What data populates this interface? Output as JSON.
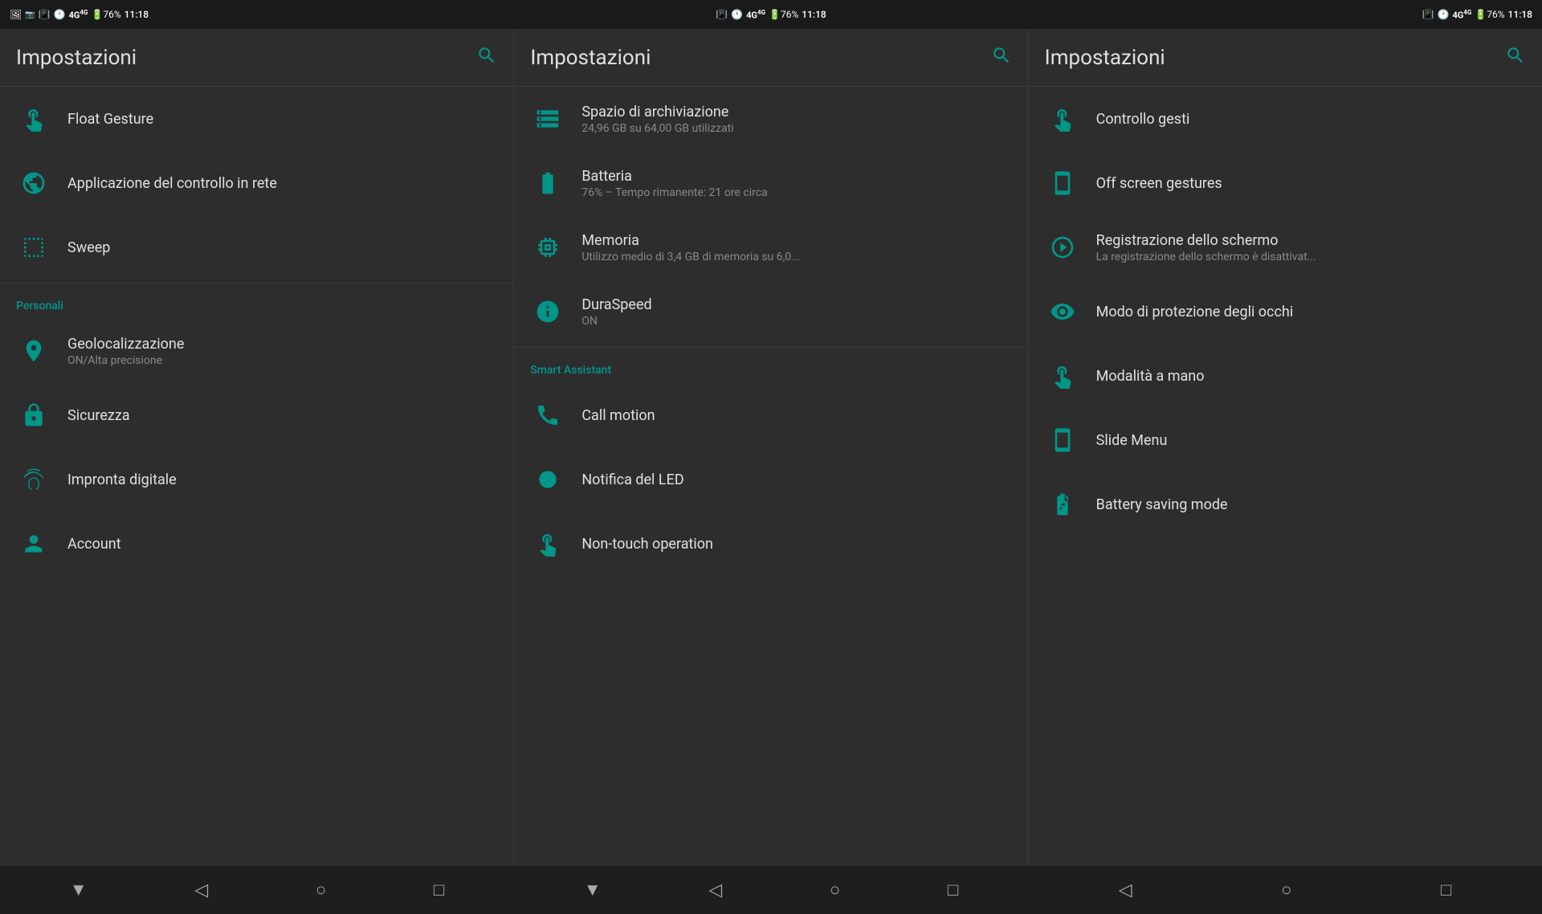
{
  "statusBar": {
    "panels": [
      {
        "icons": "📶 🔔 4G⁴ᴳ 🔋 76% 11:18"
      },
      {
        "icons": "📶 🔔 4G⁴ᴳ 🔋 76% 11:18"
      },
      {
        "icons": "📶 🔔 4G⁴ᴳ 🔋 76% 11:18"
      }
    ]
  },
  "panels": [
    {
      "id": "panel1",
      "title": "Impostazioni",
      "items": [
        {
          "id": "float-gesture",
          "icon": "gesture",
          "title": "Float Gesture",
          "subtitle": ""
        },
        {
          "id": "app-network",
          "icon": "network",
          "title": "Applicazione del controllo in rete",
          "subtitle": ""
        },
        {
          "id": "sweep",
          "icon": "sweep",
          "title": "Sweep",
          "subtitle": ""
        },
        {
          "id": "section-personali",
          "type": "section",
          "label": "Personali"
        },
        {
          "id": "geoloc",
          "icon": "location",
          "title": "Geolocalizzazione",
          "subtitle": "ON/Alta precisione"
        },
        {
          "id": "sicurezza",
          "icon": "lock",
          "title": "Sicurezza",
          "subtitle": ""
        },
        {
          "id": "impronta",
          "icon": "fingerprint",
          "title": "Impronta digitale",
          "subtitle": ""
        },
        {
          "id": "account",
          "icon": "account",
          "title": "Account",
          "subtitle": ""
        }
      ]
    },
    {
      "id": "panel2",
      "title": "Impostazioni",
      "items": [
        {
          "id": "storage",
          "icon": "storage",
          "title": "Spazio di archiviazione",
          "subtitle": "24,96 GB su 64,00 GB utilizzati"
        },
        {
          "id": "battery",
          "icon": "battery",
          "title": "Batteria",
          "subtitle": "76% – Tempo rimanente: 21 ore circa"
        },
        {
          "id": "memory",
          "icon": "memory",
          "title": "Memoria",
          "subtitle": "Utilizzo medio di 3,4 GB di memoria su 6,0..."
        },
        {
          "id": "duraspeed",
          "icon": "duraspeed",
          "title": "DuraSpeed",
          "subtitle": "ON"
        },
        {
          "id": "divider1",
          "type": "divider"
        },
        {
          "id": "section-smart",
          "type": "section",
          "label": "Smart Assistant"
        },
        {
          "id": "call-motion",
          "icon": "call",
          "title": "Call motion",
          "subtitle": ""
        },
        {
          "id": "led",
          "icon": "led",
          "title": "Notifica del LED",
          "subtitle": ""
        },
        {
          "id": "non-touch",
          "icon": "nontouch",
          "title": "Non-touch operation",
          "subtitle": ""
        }
      ]
    },
    {
      "id": "panel3",
      "title": "Impostazioni",
      "items": [
        {
          "id": "controllo-gesti",
          "icon": "hand",
          "title": "Controllo gesti",
          "subtitle": ""
        },
        {
          "id": "off-screen",
          "icon": "offscreen",
          "title": "Off screen gestures",
          "subtitle": ""
        },
        {
          "id": "registrazione",
          "icon": "screenrec",
          "title": "Registrazione dello schermo",
          "subtitle": "La registrazione dello schermo è disattivat..."
        },
        {
          "id": "protezione-occhi",
          "icon": "eye",
          "title": "Modo di protezione degli occhi",
          "subtitle": ""
        },
        {
          "id": "modalita-mano",
          "icon": "hand2",
          "title": "Modalità a mano",
          "subtitle": ""
        },
        {
          "id": "slide-menu",
          "icon": "slidemenu",
          "title": "Slide Menu",
          "subtitle": ""
        },
        {
          "id": "battery-saving",
          "icon": "batterysave",
          "title": "Battery saving mode",
          "subtitle": ""
        }
      ]
    }
  ],
  "navBar": {
    "buttons": [
      "▼",
      "◁",
      "○",
      "□"
    ]
  }
}
